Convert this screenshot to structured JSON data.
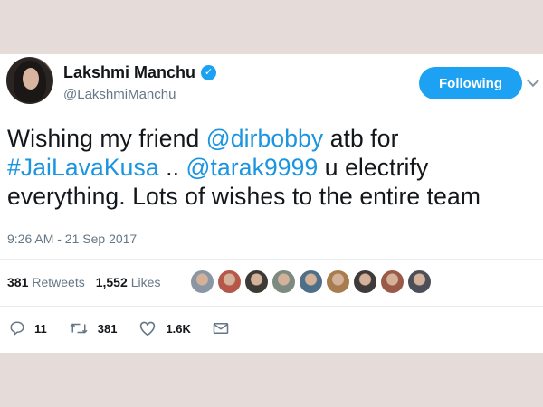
{
  "tweet": {
    "display_name": "Lakshmi Manchu",
    "handle": "@LakshmiManchu",
    "follow_label": "Following",
    "text_lines": [
      [
        {
          "t": "Wishing my friend ",
          "m": false
        },
        {
          "t": "@dirbobby",
          "m": true
        },
        {
          "t": " atb for",
          "m": false
        }
      ],
      [
        {
          "t": "#JaiLavaKusa",
          "m": true
        },
        {
          "t": " .. ",
          "m": false
        },
        {
          "t": "@tarak9999",
          "m": true
        },
        {
          "t": " u electrify",
          "m": false
        }
      ],
      [
        {
          "t": "everything. Lots of wishes to the entire team",
          "m": false
        }
      ]
    ],
    "timestamp": "9:26 AM - 21 Sep 2017"
  },
  "stats": {
    "retweets_count": "381",
    "retweets_label": "Retweets",
    "likes_count": "1,552",
    "likes_label": "Likes",
    "liker_avatars": [
      "#8a96a3",
      "#b5584a",
      "#3d3a36",
      "#7c8a7f",
      "#4f6f88",
      "#a77c4e",
      "#3f3b3a",
      "#9b5a48",
      "#4c4e58"
    ]
  },
  "actions": {
    "reply_count": "11",
    "retweet_count": "381",
    "like_count": "1.6K"
  },
  "colors": {
    "accent": "#1da1f2",
    "mention": "#1b95e0",
    "background": "#e5dcd9"
  },
  "icons": {
    "verified": "verified-badge-icon",
    "reply": "reply-icon",
    "retweet": "retweet-icon",
    "like": "heart-icon",
    "dm": "envelope-icon"
  }
}
